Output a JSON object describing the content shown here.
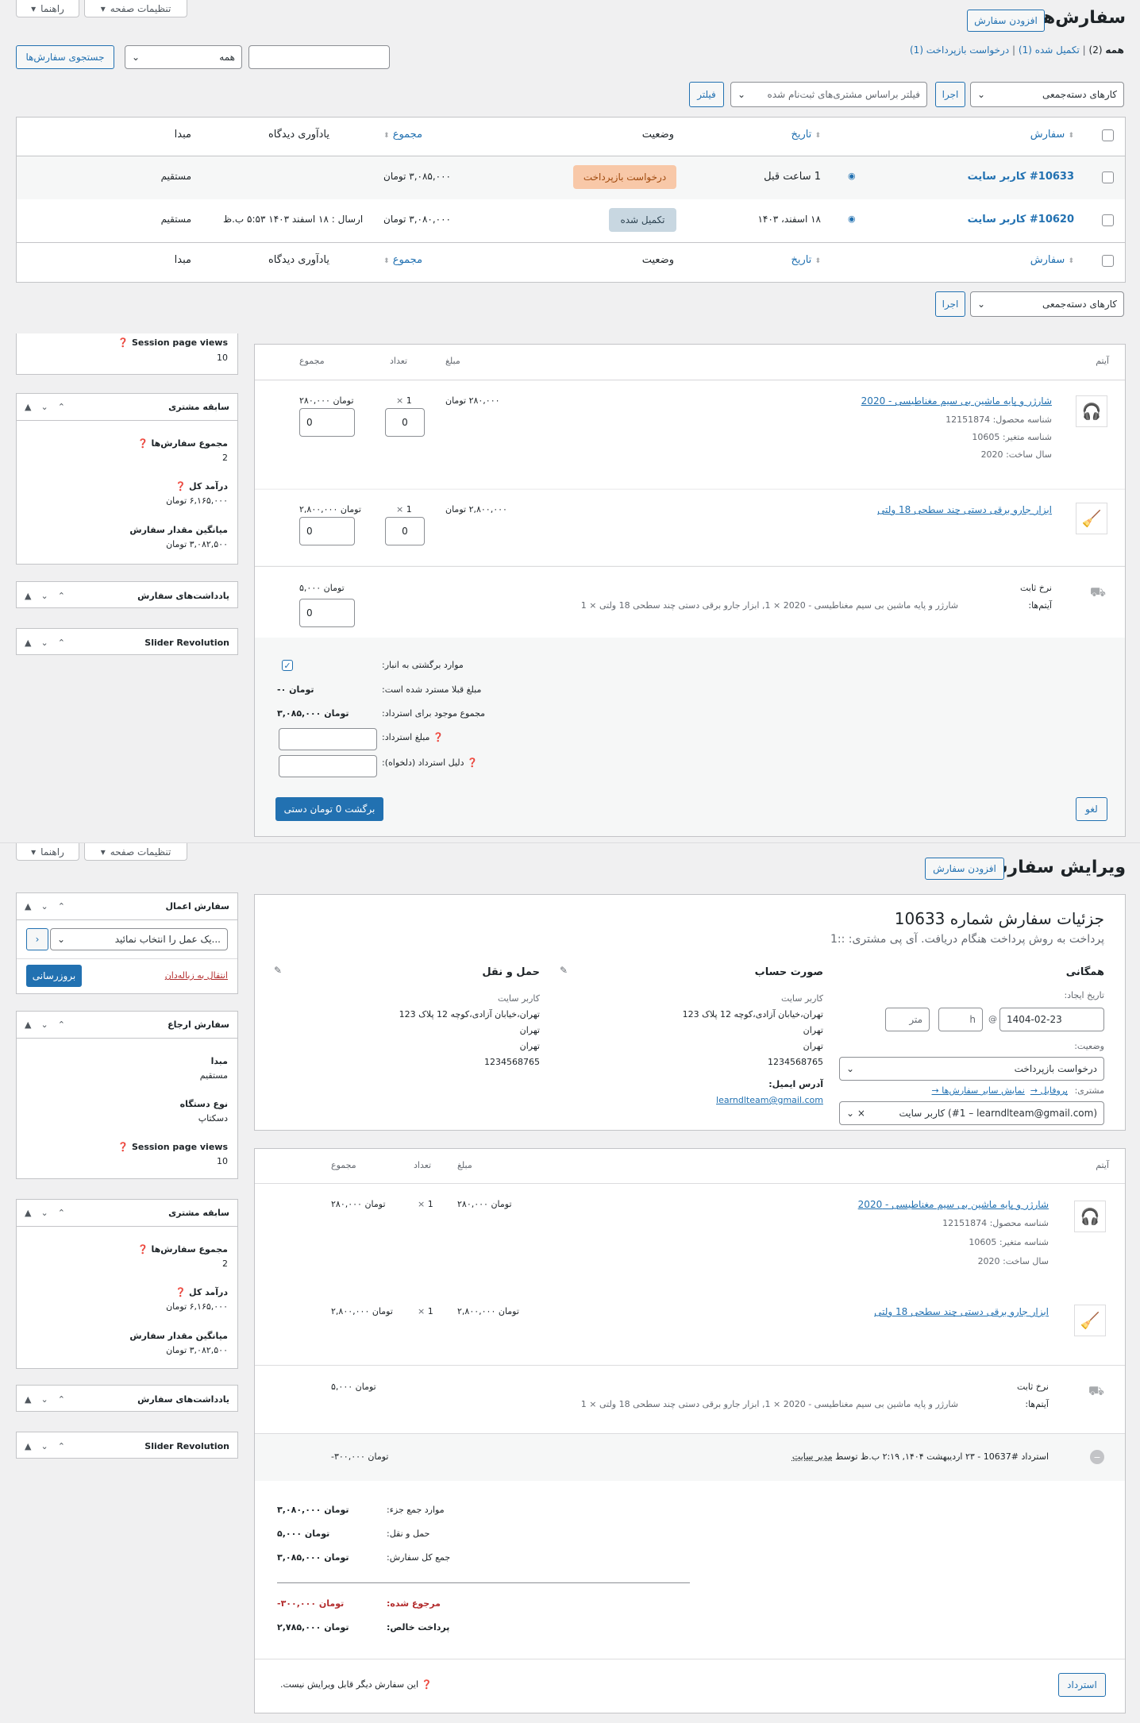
{
  "top_tabs": {
    "screen_options": "تنظیمات صفحه",
    "help": "راهنما"
  },
  "orders_list": {
    "title": "سفارش‌ها",
    "add_order": "افزودن سفارش",
    "views": {
      "all": "همه",
      "all_count": "(2)",
      "completed": "تکمیل شده (1)",
      "refund_requested": "درخواست بازپرداخت (1)",
      "separator": "|"
    },
    "search_button": "جستجوی سفارش‌ها",
    "status_select": "همه",
    "bulk_actions": "کارهای دسته‌جمعی",
    "apply": "اجرا",
    "customer_filter_placeholder": "فیلتر براساس مشتری‌های ثبت‌نام شده",
    "filter": "فیلتر",
    "columns": {
      "order": "سفارش",
      "date": "تاریخ",
      "status": "وضعیت",
      "total": "مجموع",
      "reminder": "یادآوری دیدگاه",
      "origin": "مبدا"
    },
    "rows": [
      {
        "order": "#10633 کاربر سایت",
        "date": "1 ساعت قبل",
        "status": "درخواست بازپرداخت",
        "total": "۳,۰۸۵,۰۰۰ تومان",
        "reminder": "",
        "origin": "مستقیم"
      },
      {
        "order": "#10620 کاربر سایت",
        "date": "۱۸ اسفند، ۱۴۰۳",
        "status": "تکمیل شده",
        "total": "۳,۰۸۰,۰۰۰ تومان",
        "reminder": "ارسال : ۱۸ اسفند ۱۴۰۳ ۵:۵۳ ب.ظ",
        "origin": "مستقیم"
      }
    ]
  },
  "refund_panel": {
    "col_item": "آیتم",
    "col_cost": "مبلغ",
    "col_qty": "تعداد",
    "col_total": "مجموع",
    "items": [
      {
        "name": "شارژر و پایه ماشین بی سیم مغناطیسی - 2020",
        "sku_label": "شناسه محصول:",
        "sku": "12151874",
        "var_label": "شناسه متغیر:",
        "var": "10605",
        "year_label": "سال ساخت:",
        "year": "2020",
        "cost": "۲۸۰,۰۰۰ تومان",
        "qty": "1",
        "x": "×",
        "total": "۲۸۰,۰۰۰ تومان",
        "refund_qty": "0",
        "refund_total": "0"
      },
      {
        "name": "ابزار جارو برقی دستی چند سطحی 18 ولتی",
        "cost": "۲,۸۰۰,۰۰۰ تومان",
        "qty": "1",
        "x": "×",
        "total": "۲,۸۰۰,۰۰۰ تومان",
        "refund_qty": "0",
        "refund_total": "0"
      }
    ],
    "shipping": {
      "name": "نرخ ثابت",
      "items_label": "آیتم‌ها:",
      "items": "شارژر و پایه ماشین بی سیم مغناطیسی - 2020 × 1, ابزار جارو برقی دستی چند سطحی 18 ولتی × 1",
      "total": "۵,۰۰۰ تومان",
      "refund_total": "0"
    },
    "restock_label": "موارد برگشتی به انبار:",
    "already_refunded_label": "مبلغ قبلا مسترد شده است:",
    "already_refunded": "-۰ تومان",
    "available_label": "مجموع موجود برای استرداد:",
    "available": "۳,۰۸۵,۰۰۰ تومان",
    "amount_label": "مبلغ استرداد:",
    "reason_label": "دلیل استرداد (دلخواه):",
    "manual_refund": "برگشت 0 تومان دستی",
    "cancel": "لغو"
  },
  "sidebar_top": {
    "session_label": "Session page views",
    "session": "10",
    "customer_history": "سابقه مشتری",
    "total_orders_label": "مجموع سفارش‌ها",
    "total_orders": "2",
    "revenue_label": "درآمد کل",
    "revenue": "۶,۱۶۵,۰۰۰ تومان",
    "avg_label": "میانگین مقدار سفارش",
    "avg": "۳,۰۸۲,۵۰۰ تومان",
    "order_notes": "یادداشت‌های سفارش",
    "slider": "Slider Revolution"
  },
  "edit_order": {
    "title": "ویرایش سفارش",
    "add_order": "افزودن سفارش",
    "heading": "جزئیات سفارش شماره 10633",
    "subheading": "پرداخت به روش پرداخت هنگام دریافت. آی پی مشتری: ::1",
    "general": "همگانی",
    "created_label": "تاریخ ایجاد:",
    "created_date": "1404-02-23",
    "at": "@",
    "hour": "h",
    "minute": "متر",
    "status_label": "وضعیت:",
    "status": "درخواست بازپرداخت",
    "customer_label": "مشتری:",
    "profile_link": "پروفایل →",
    "other_orders_link": "نمایش سایر سفارش‌ها →",
    "customer": "کاربر سایت (#1 – learndlteam@gmail.com)",
    "billing_title": "صورت حساب",
    "billing_lines": [
      "کاربر سایت",
      "تهران،خیابان آزادی،کوچه 12 پلاک 123",
      "تهران",
      "تهران",
      "1234568765"
    ],
    "email_label": "آدرس ایمیل:",
    "email": "learndlteam@gmail.com",
    "shipping_title": "حمل و نقل",
    "shipping_lines": [
      "کاربر سایت",
      "تهران،خیابان آزادی،کوچه 12 پلاک 123",
      "تهران",
      "تهران",
      "1234568765"
    ]
  },
  "sidebar_bottom": {
    "actions_title": "سفارش اعمال",
    "action_select": "یک عمل را انتخاب نمائید...",
    "trash": "انتقال به زباله‌دان",
    "update": "بروزرسانی",
    "attribution_title": "سفارش ارجاع",
    "origin_label": "مبدا",
    "origin": "مستقیم",
    "device_label": "نوع دستگاه",
    "device": "دسکتاپ",
    "session_label": "Session page views",
    "session": "10",
    "customer_history": "سابقه مشتری",
    "total_orders_label": "مجموع سفارش‌ها",
    "total_orders": "2",
    "revenue_label": "درآمد کل",
    "revenue": "۶,۱۶۵,۰۰۰ تومان",
    "avg_label": "میانگین مقدار سفارش",
    "avg": "۳,۰۸۲,۵۰۰ تومان",
    "order_notes": "یادداشت‌های سفارش",
    "slider": "Slider Revolution"
  },
  "items_panel": {
    "col_item": "آیتم",
    "col_cost": "مبلغ",
    "col_qty": "تعداد",
    "col_total": "مجموع",
    "items": [
      {
        "name": "شارژر و پایه ماشین بی سیم مغناطیسی - 2020",
        "sku_label": "شناسه محصول:",
        "sku": "12151874",
        "var_label": "شناسه متغیر:",
        "var": "10605",
        "year_label": "سال ساخت:",
        "year": "2020",
        "cost": "۲۸۰,۰۰۰ تومان",
        "qty": "1",
        "x": "×",
        "total": "۲۸۰,۰۰۰ تومان"
      },
      {
        "name": "ابزار جارو برقی دستی چند سطحی 18 ولتی",
        "cost": "۲,۸۰۰,۰۰۰ تومان",
        "qty": "1",
        "x": "×",
        "total": "۲,۸۰۰,۰۰۰ تومان"
      }
    ],
    "shipping": {
      "name": "نرخ ثابت",
      "items_label": "آیتم‌ها:",
      "items": "شارژر و پایه ماشین بی سیم مغناطیسی - 2020 × 1, ابزار جارو برقی دستی چند سطحی 18 ولتی × 1",
      "total": "۵,۰۰۰ تومان"
    },
    "refund_line": "استرداد #10637 - ۲۳ اردیبهشت ۱۴۰۴, ۲:۱۹ ب.ظ توسط",
    "refund_by": "مدیر سایت",
    "refund_amount": "-۳۰۰,۰۰۰ تومان",
    "subtotal_label": "موارد جمع جزء:",
    "subtotal": "۳,۰۸۰,۰۰۰ تومان",
    "shipping_label": "حمل و نقل:",
    "shipping_total": "۵,۰۰۰ تومان",
    "order_total_label": "جمع کل سفارش:",
    "order_total": "۳,۰۸۵,۰۰۰ تومان",
    "refunded_label": "مرجوع شده:",
    "refunded": "-۳۰۰,۰۰۰ تومان",
    "net_label": "پرداخت خالص:",
    "net": "۲,۷۸۵,۰۰۰ تومان",
    "refund_button": "استرداد",
    "not_editable": "این سفارش دیگر قابل ویرایش نیست."
  },
  "colors": {
    "accent": "#2271b1",
    "refund_status_bg": "#f8c8a8",
    "refund_status_text": "#a04a0e",
    "complete_status_bg": "#c8d7e1",
    "complete_status_text": "#2e4453",
    "red": "#b32d2e"
  }
}
